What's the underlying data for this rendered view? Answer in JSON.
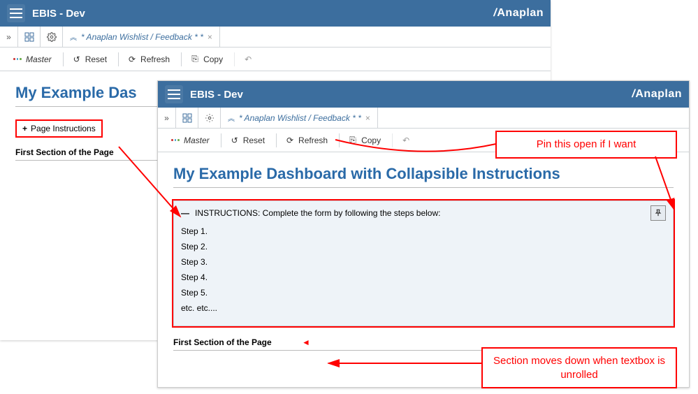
{
  "common": {
    "app_title": "EBIS - Dev",
    "brand": "Anaplan",
    "tab_label": "* Anaplan Wishlist / Feedback * *",
    "toolbar": {
      "master": "Master",
      "reset": "Reset",
      "refresh": "Refresh",
      "copy": "Copy"
    }
  },
  "back": {
    "dash_title_truncated": "My Example Das",
    "collapsed_label": "Page Instructions",
    "section1": "First Section of the Page"
  },
  "front": {
    "dash_title": "My Example Dashboard with Collapsible Instructions",
    "inst_title": "INSTRUCTIONS: Complete the form by following the steps below:",
    "steps": [
      "Step 1.",
      "Step 2.",
      "Step 3.",
      "Step 4.",
      "Step 5.",
      "etc. etc...."
    ],
    "section1": "First Section of the Page"
  },
  "callouts": {
    "pin": "Pin this open if I want",
    "section_moves": "Section moves down when textbox is unrolled"
  }
}
